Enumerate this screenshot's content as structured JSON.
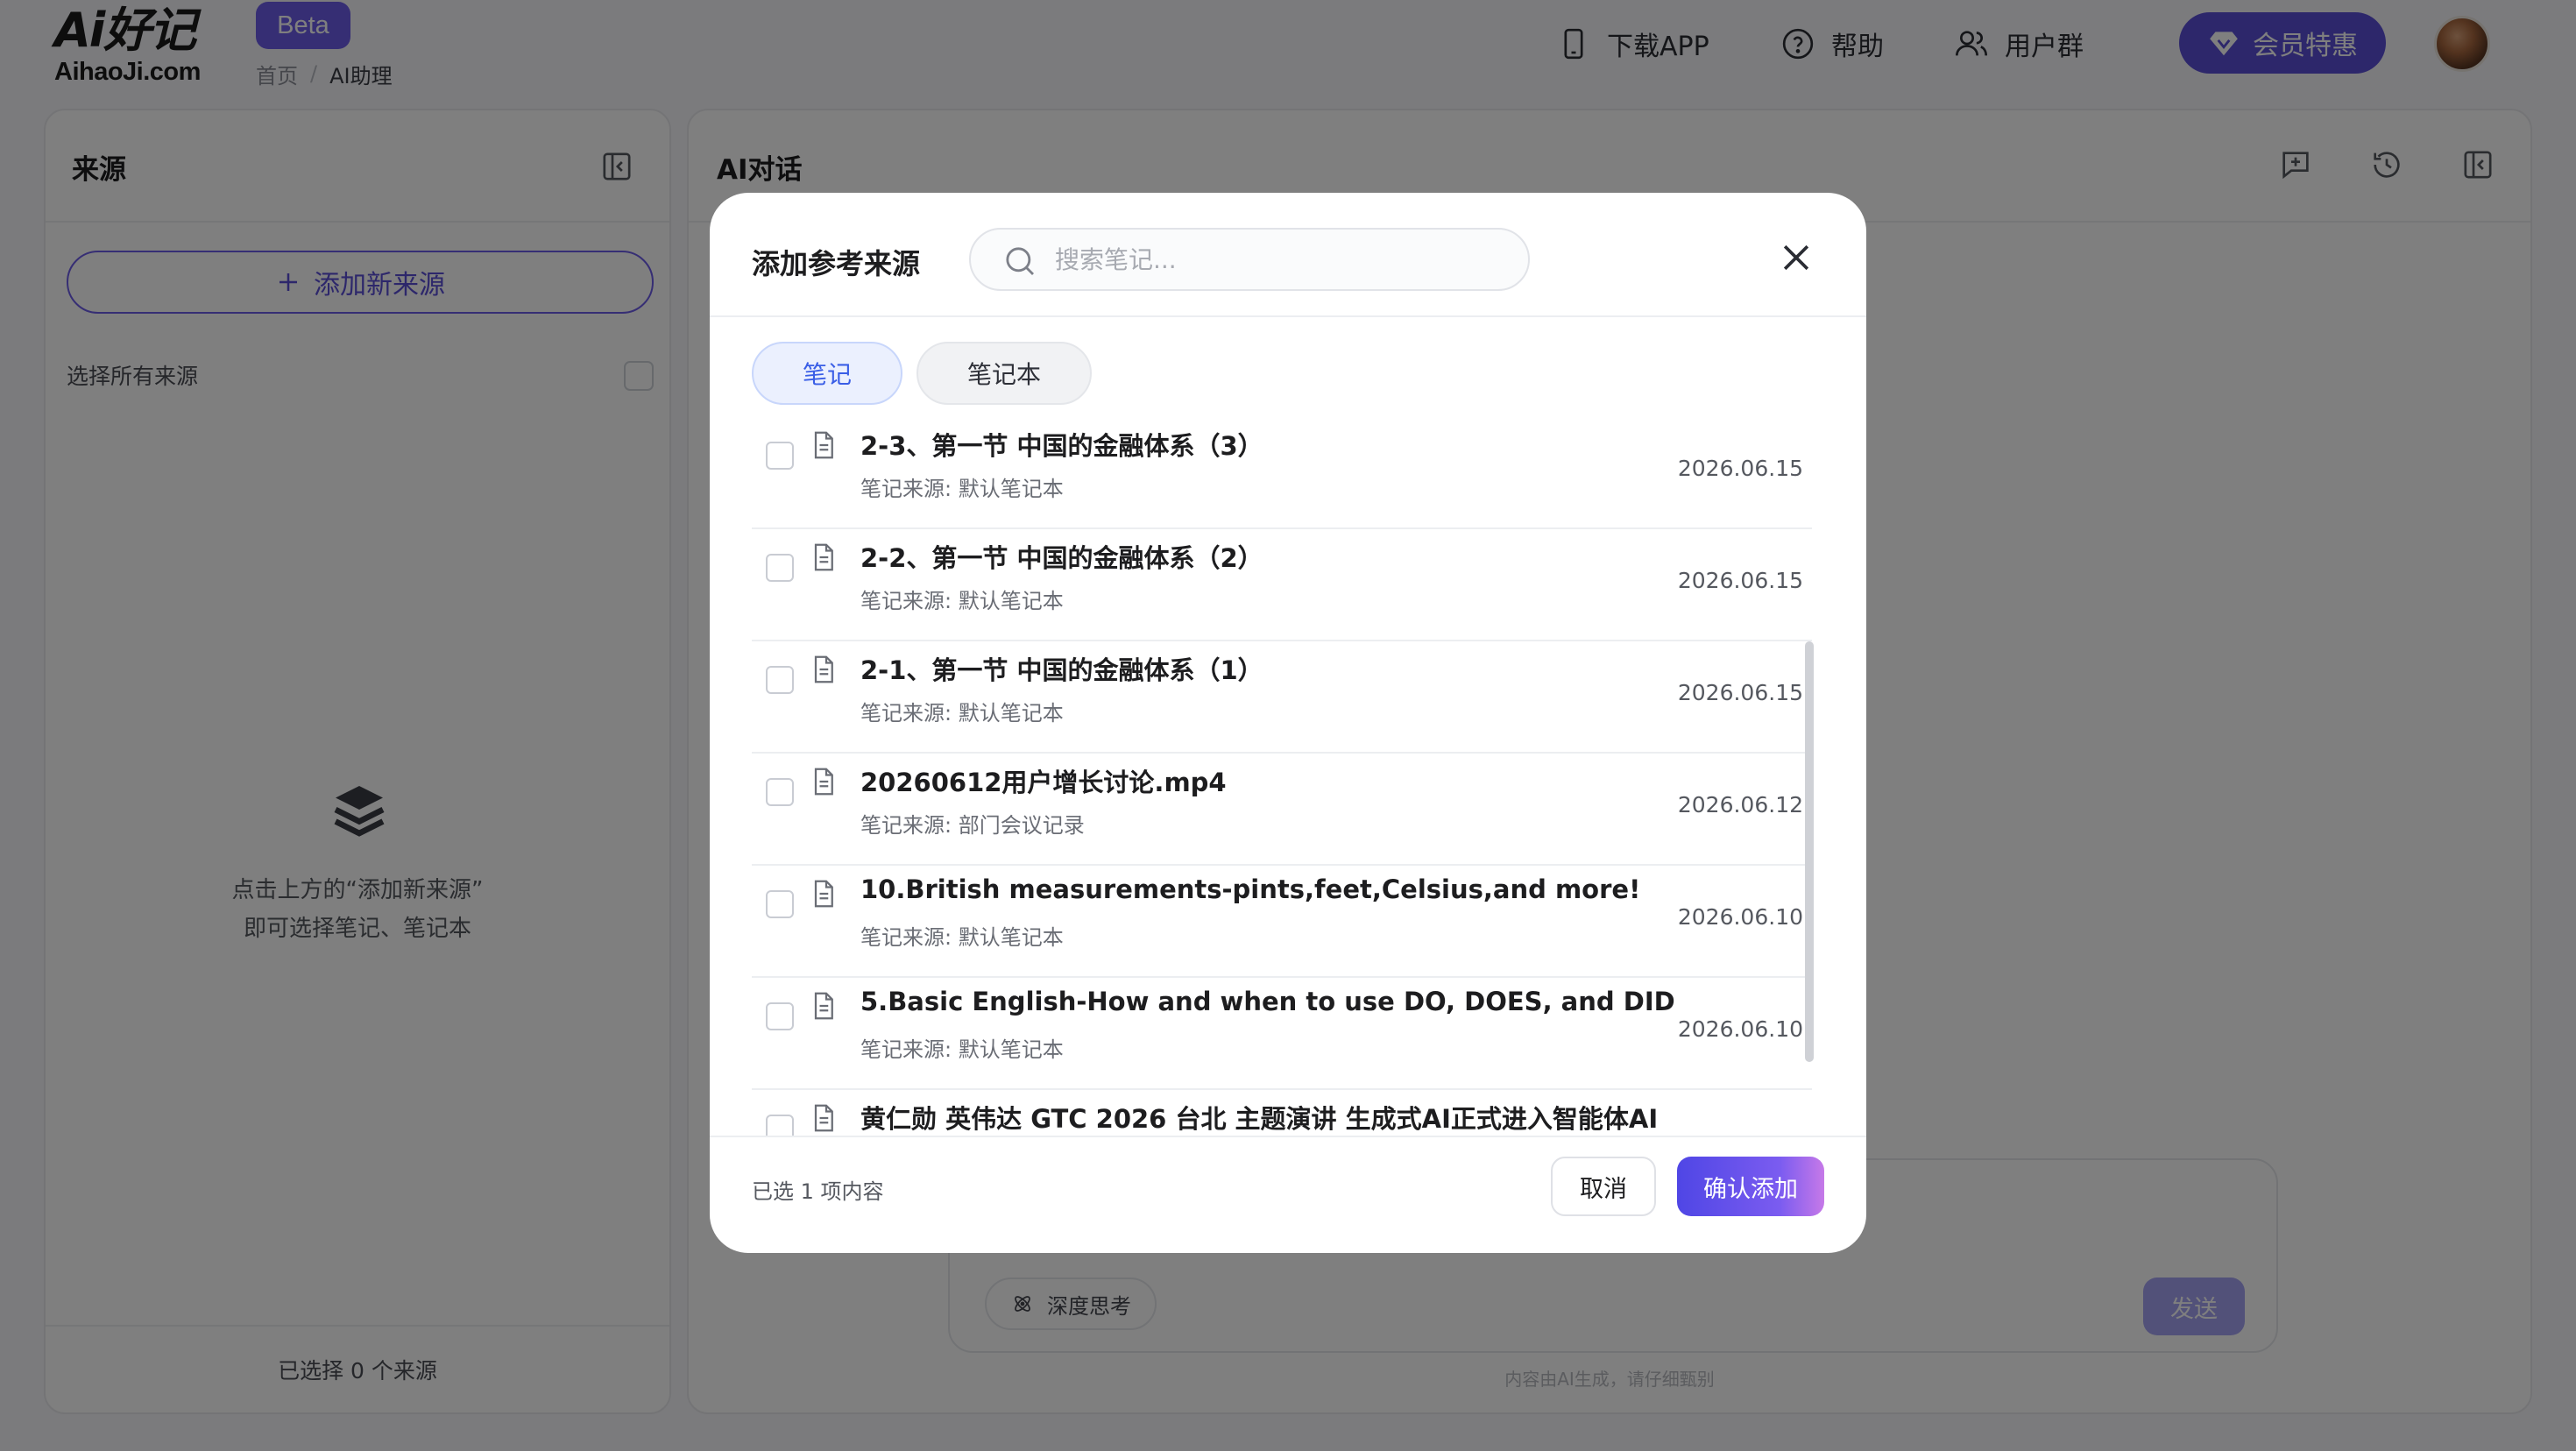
{
  "header": {
    "logo_top": "Ai好记",
    "logo_bottom": "AihaoJi.com",
    "beta": "Beta",
    "breadcrumb": [
      "首页",
      "/",
      "AI助理"
    ],
    "nav": {
      "download": "下载APP",
      "help": "帮助",
      "group": "用户群",
      "vip": "会员特惠"
    }
  },
  "left_panel": {
    "title": "来源",
    "add_button": "添加新来源",
    "select_all": "选择所有来源",
    "empty_line1": "点击上方的“添加新来源”",
    "empty_line2": "即可选择笔记、笔记本",
    "footer": "已选择 0 个来源"
  },
  "right_panel": {
    "title": "AI对话",
    "deep_think": "深度思考",
    "send": "发送",
    "disclaimer": "内容由AI生成，请仔细甄别"
  },
  "modal": {
    "title": "添加参考来源",
    "search_placeholder": "搜索笔记...",
    "tabs": [
      "笔记",
      "笔记本"
    ],
    "active_tab": "笔记",
    "items": [
      {
        "title": "2-3、第一节 中国的金融体系（3）",
        "source": "笔记来源: 默认笔记本",
        "date": "2026.06.15"
      },
      {
        "title": "2-2、第一节 中国的金融体系（2）",
        "source": "笔记来源: 默认笔记本",
        "date": "2026.06.15"
      },
      {
        "title": "2-1、第一节 中国的金融体系（1）",
        "source": "笔记来源: 默认笔记本",
        "date": "2026.06.15"
      },
      {
        "title": "20260612用户增长讨论.mp4",
        "source": "笔记来源: 部门会议记录",
        "date": "2026.06.12"
      },
      {
        "title": "10.British measurements-pints,feet,Celsius,and more!",
        "source": "笔记来源: 默认笔记本",
        "date": "2026.06.10"
      },
      {
        "title": "5.Basic English-How and when to use DO, DOES, and DID",
        "source": "笔记来源: 默认笔记本",
        "date": "2026.06.10"
      },
      {
        "title": "黄仁勋 英伟达 GTC 2026 台北 主题演讲 生成式AI正式进入智能体AI",
        "source": "",
        "date": ""
      }
    ],
    "selected_text": "已选 1 项内容",
    "cancel": "取消",
    "confirm": "确认添加"
  },
  "colors": {
    "accent": "#5b4fd6",
    "beta_bg": "#6d5ce8",
    "tab_active_text": "#3a5ee6",
    "overlay": "rgba(0,0,0,0.5)"
  },
  "icons": [
    "phone-icon",
    "help-icon",
    "users-icon",
    "diamond-icon",
    "collapse-panel-icon",
    "plus-icon",
    "layers-icon",
    "new-chat-icon",
    "history-icon",
    "search-icon",
    "close-icon",
    "document-icon",
    "atom-icon"
  ]
}
